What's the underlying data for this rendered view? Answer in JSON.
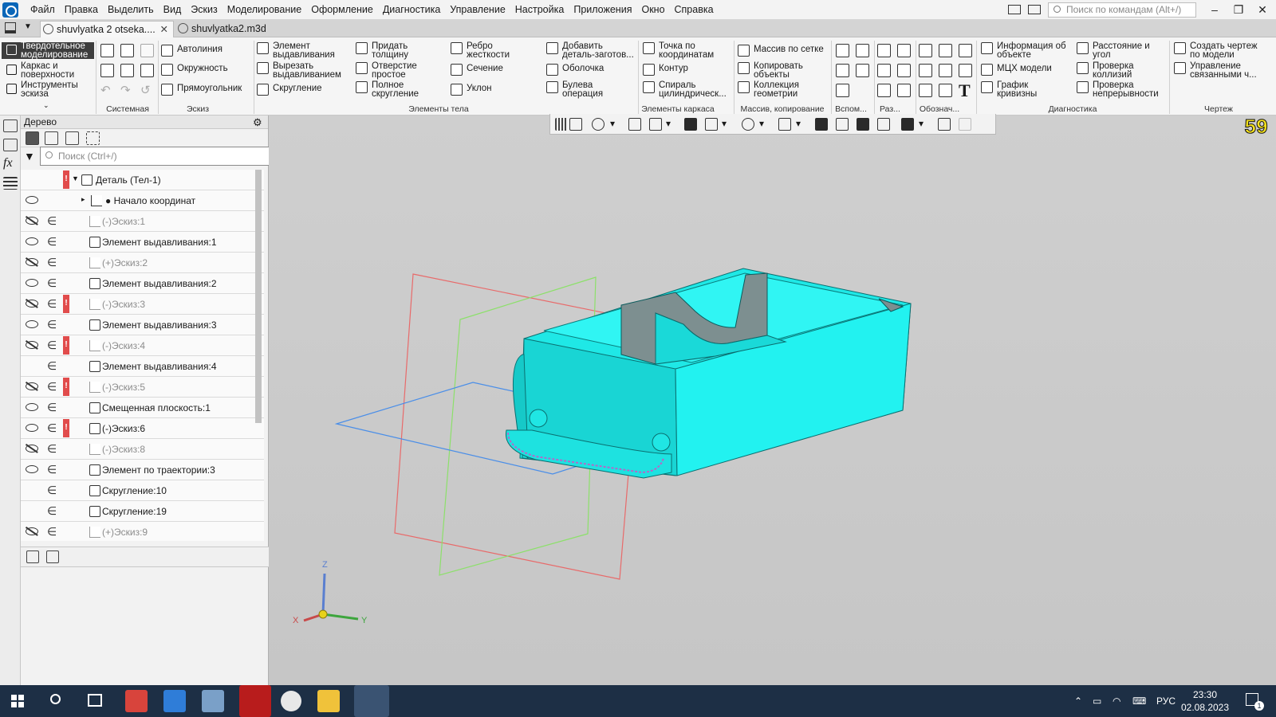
{
  "menubar": {
    "items": [
      "Файл",
      "Правка",
      "Выделить",
      "Вид",
      "Эскиз",
      "Моделирование",
      "Оформление",
      "Диагностика",
      "Управление",
      "Настройка",
      "Приложения",
      "Окно",
      "Справка"
    ],
    "search_placeholder": "Поиск по командам (Alt+/)"
  },
  "tabs": [
    {
      "label": "shuvlyatka 2 otseka...."
    },
    {
      "label": "shuvlyatka2.m3d"
    }
  ],
  "ribbon": {
    "modes": [
      "Твердотельное\nмоделирование",
      "Каркас и\nповерхности",
      "Инструменты\nэскиза"
    ],
    "sketch": [
      "Автолиния",
      "Окружность",
      "Прямоугольник"
    ],
    "body": [
      "Элемент\nвыдавливания",
      "Вырезать\nвыдавливанием",
      "Скругление",
      "Придать\nтолщину",
      "Отверстие\nпростое",
      "Полное\nскругление",
      "Ребро\nжесткости",
      "Сечение",
      "Уклон",
      "Добавить\nдеталь-заготов...",
      "Оболочка",
      "Булева\nоперация"
    ],
    "frame": [
      "Точка по\nкоординатам",
      "Контур",
      "Спираль\nцилиндрическ..."
    ],
    "array": [
      "Массив по сетке",
      "Копировать\nобъекты",
      "Коллекция\nгеометрии"
    ],
    "diag": [
      "Информация об\nобъекте",
      "МЦХ модели",
      "График\nкривизны",
      "Расстояние и\nугол",
      "Проверка\nколлизий",
      "Проверка\nнепрерывности"
    ],
    "drawing": [
      "Создать чертеж\nпо модели",
      "Управление\nсвязанными ч..."
    ],
    "groups": [
      "Системная",
      "Эскиз",
      "Элементы тела",
      "Элементы каркаса",
      "Массив, копирование",
      "Вспом...",
      "Раз...",
      "Обознач...",
      "Диагностика",
      "Чертеж"
    ]
  },
  "tree": {
    "title": "Дерево",
    "search_placeholder": "Поиск (Ctrl+/)",
    "rows": [
      {
        "label": "Деталь (Тел-1)",
        "eye": "none",
        "rel": false,
        "err": true,
        "indent": 1,
        "dim": false
      },
      {
        "label": "● Начало координат",
        "eye": "on",
        "rel": false,
        "err": false,
        "indent": 2,
        "dim": false
      },
      {
        "label": "(-)Эскиз:1",
        "eye": "off",
        "rel": true,
        "err": false,
        "indent": 3,
        "dim": true
      },
      {
        "label": "Элемент выдавливания:1",
        "eye": "on",
        "rel": true,
        "err": false,
        "indent": 3,
        "dim": false
      },
      {
        "label": "(+)Эскиз:2",
        "eye": "off",
        "rel": true,
        "err": false,
        "indent": 3,
        "dim": true
      },
      {
        "label": "Элемент выдавливания:2",
        "eye": "on",
        "rel": true,
        "err": false,
        "indent": 3,
        "dim": false
      },
      {
        "label": "(-)Эскиз:3",
        "eye": "off",
        "rel": true,
        "err": true,
        "indent": 3,
        "dim": true
      },
      {
        "label": "Элемент выдавливания:3",
        "eye": "on",
        "rel": true,
        "err": false,
        "indent": 3,
        "dim": false
      },
      {
        "label": "(-)Эскиз:4",
        "eye": "off",
        "rel": true,
        "err": true,
        "indent": 3,
        "dim": true
      },
      {
        "label": "Элемент выдавливания:4",
        "eye": "none",
        "rel": true,
        "err": false,
        "indent": 3,
        "dim": false
      },
      {
        "label": "(-)Эскиз:5",
        "eye": "off",
        "rel": true,
        "err": true,
        "indent": 3,
        "dim": true
      },
      {
        "label": "Смещенная плоскость:1",
        "eye": "on",
        "rel": true,
        "err": false,
        "indent": 3,
        "dim": false
      },
      {
        "label": "(-)Эскиз:6",
        "eye": "on",
        "rel": true,
        "err": true,
        "indent": 3,
        "dim": false
      },
      {
        "label": "(-)Эскиз:8",
        "eye": "off",
        "rel": true,
        "err": false,
        "indent": 3,
        "dim": true
      },
      {
        "label": "Элемент по траектории:3",
        "eye": "on",
        "rel": true,
        "err": false,
        "indent": 3,
        "dim": false
      },
      {
        "label": "Скругление:10",
        "eye": "none",
        "rel": true,
        "err": false,
        "indent": 3,
        "dim": false
      },
      {
        "label": "Скругление:19",
        "eye": "none",
        "rel": true,
        "err": false,
        "indent": 3,
        "dim": false
      },
      {
        "label": "(+)Эскиз:9",
        "eye": "off",
        "rel": true,
        "err": false,
        "indent": 3,
        "dim": true
      }
    ]
  },
  "viewport": {
    "fps": "59",
    "axes": {
      "x": "X",
      "y": "Y",
      "z": "Z"
    },
    "model_color": "#21f0ee"
  },
  "taskbar": {
    "lang": "РУС",
    "time": "23:30",
    "date": "02.08.2023",
    "notif": "1"
  }
}
